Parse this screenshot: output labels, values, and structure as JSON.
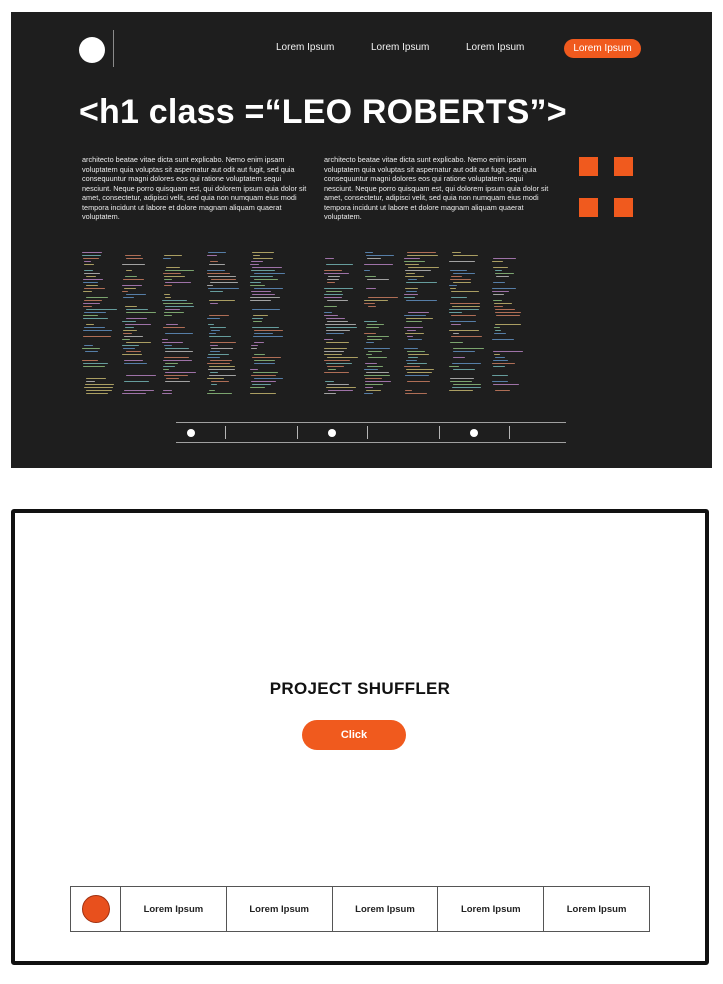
{
  "header": {
    "nav_links": [
      "Lorem Ipsum",
      "Lorem Ipsum",
      "Lorem Ipsum"
    ],
    "cta_label": "Lorem Ipsum"
  },
  "hero": {
    "title": "<h1 class =“LEO ROBERTS”>",
    "paragraphs": [
      "architecto beatae vitae dicta sunt explicabo. Nemo enim ipsam voluptatem quia voluptas sit aspernatur aut odit aut fugit, sed quia consequuntur magni dolores eos qui ratione voluptatem sequi nesciunt. Neque porro quisquam est, qui dolorem ipsum quia dolor sit amet, consectetur, adipisci velit, sed quia non numquam eius modi tempora incidunt ut labore et dolore magnam aliquam quaerat voluptatem.",
      "architecto beatae vitae dicta sunt explicabo. Nemo enim ipsam voluptatem quia voluptas sit aspernatur aut odit aut fugit, sed quia consequuntur magni dolores eos qui ratione voluptatem sequi nesciunt. Neque porro quisquam est, qui dolorem ipsum quia dolor sit amet, consectetur, adipisci velit, sed quia non numquam eius modi tempora incidunt ut labore et dolore magnam aliquam quaerat voluptatem."
    ],
    "accent_color": "#f05a1e"
  },
  "wireframe": {
    "title": "PROJECT SHUFFLER",
    "button_label": "Click",
    "nav_items": [
      "Lorem Ipsum",
      "Lorem Ipsum",
      "Lorem Ipsum",
      "Lorem Ipsum",
      "Lorem Ipsum"
    ]
  }
}
